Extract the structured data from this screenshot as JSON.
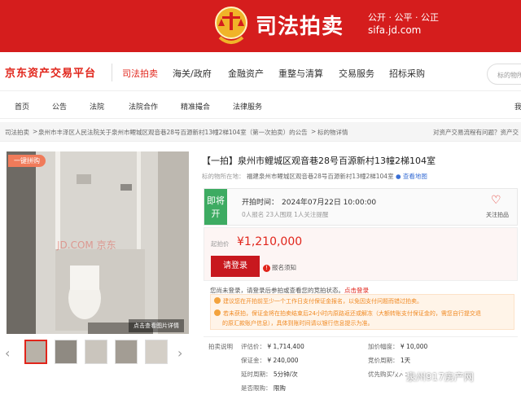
{
  "banner": {
    "title": "司法拍卖",
    "slogan": "公开 · 公平 · 公正",
    "domain": "sifa.jd.com"
  },
  "nav_main": {
    "logo": "京东资产交易平台",
    "items": [
      "司法拍卖",
      "海关/政府",
      "金融资产",
      "重整与清算",
      "交易服务",
      "招标采购"
    ],
    "search_placeholder": "标的物所"
  },
  "nav_sub": {
    "items": [
      "首页",
      "公告",
      "法院",
      "法院合作",
      "精准撮合",
      "法律服务"
    ],
    "right": "我"
  },
  "breadcrumb": {
    "items": [
      "司法拍卖",
      ">",
      "泉州市丰泽区人民法院关于泉州市鲤城区观音巷28号百源新村13幢2梯104室（第一次拍卖）的公告",
      ">",
      "标的物详情"
    ],
    "help": "对资产交易流程有问题？资产交"
  },
  "gallery": {
    "badge": "一键拼购",
    "zoom_tip": "点击查看图片详情",
    "watermark": "JD.COM 京东",
    "prev": "‹",
    "next": "›"
  },
  "lot": {
    "title": "【一拍】泉州市鲤城区观音巷28号百源新村13幢2梯104室",
    "addr_label": "标的物所在地：",
    "addr_value": "福建泉州市鲤城区观音巷28号百源新村13幢2梯104室",
    "map_link": "查看地图"
  },
  "status": {
    "tag": "即将开",
    "start_label": "开拍时间：",
    "start_time": "2024年07月22日 10:00:00",
    "stats": "0人报名    23人围观    1人关注提醒",
    "fav": "关注拍品"
  },
  "price": {
    "label": "起拍价",
    "value": "¥1,210,000",
    "signup": "请登录",
    "rules": "报名须知"
  },
  "notice": {
    "text": "您尚未登录，请登录后参拍或查看您的竞拍状态。",
    "link": "点击登录"
  },
  "tips": {
    "t1": "建议您在开拍前至少一个工作日支付保证金报名，以免因支付问题而错过拍卖。",
    "t2": "若未获拍，保证金将在拍卖结束后24小时内原路返还或解冻（大额转账支付保证金的，需您自行提交退",
    "t3": "的原汇款账户信息），具体到账时间请以银行信息提示为准。"
  },
  "details": {
    "row1": {
      "l1": "拍卖说明",
      "l2": "评估价：",
      "v2": "¥ 1,714,400",
      "l3": "加价幅度：",
      "v3": "¥ 10,000"
    },
    "row2": {
      "l2": "保证金：",
      "v2": "¥ 240,000",
      "l3": "竞价周期：",
      "v3": "1天"
    },
    "row3": {
      "l2": "延时周期：",
      "v2": "5分钟/次",
      "l3": "优先购买权人："
    },
    "row4": {
      "l2": "是否限购：",
      "v2": "限购"
    }
  },
  "watermark": "泉州917房产网"
}
